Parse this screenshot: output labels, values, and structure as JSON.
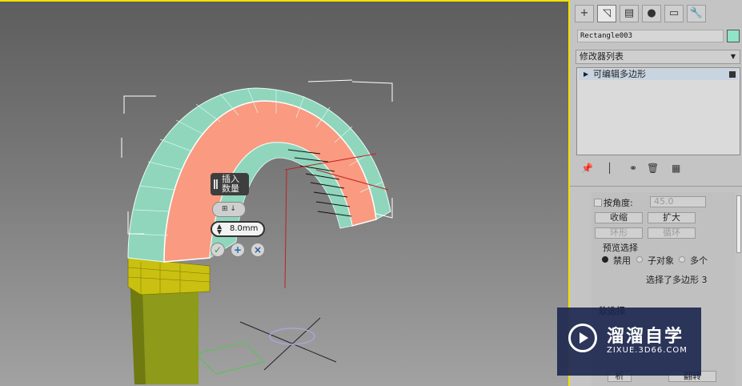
{
  "viewport": {
    "caddy": {
      "title_line1": "插入",
      "title_line2": "数量",
      "mode": "⊞ ↓",
      "amount": "8.0mm",
      "ok": "✓",
      "apply": "+",
      "cancel": "×"
    }
  },
  "command_panel": {
    "tabs": [
      {
        "icon": "+",
        "name": "create"
      },
      {
        "icon": "◹",
        "name": "modify"
      },
      {
        "icon": "▤",
        "name": "hierarchy"
      },
      {
        "icon": "●",
        "name": "motion"
      },
      {
        "icon": "▭",
        "name": "display"
      },
      {
        "icon": "🔧",
        "name": "utilities"
      }
    ],
    "object_name": "Rectangle003",
    "object_color": "#8fe3c8",
    "modifier_list_label": "修改器列表",
    "stack_items": [
      "可编辑多边形"
    ],
    "toolbar_icons": [
      "📌",
      "│",
      "⚭",
      "🗑",
      "▦"
    ]
  },
  "selection_rollout": {
    "by_angle_label": "按角度:",
    "by_angle_value": "45.0",
    "shrink": "收缩",
    "grow": "扩大",
    "ring": "环形",
    "loop": "循环",
    "preview_label": "预览选择",
    "preview_options": [
      "禁用",
      "子对象",
      "多个"
    ],
    "status": "选择了多边形 3",
    "partial_below": [
      "软选择",
      "析",
      "翻转"
    ]
  },
  "watermark": {
    "title": "溜溜自学",
    "url": "ZIXUE.3D66.COM"
  }
}
